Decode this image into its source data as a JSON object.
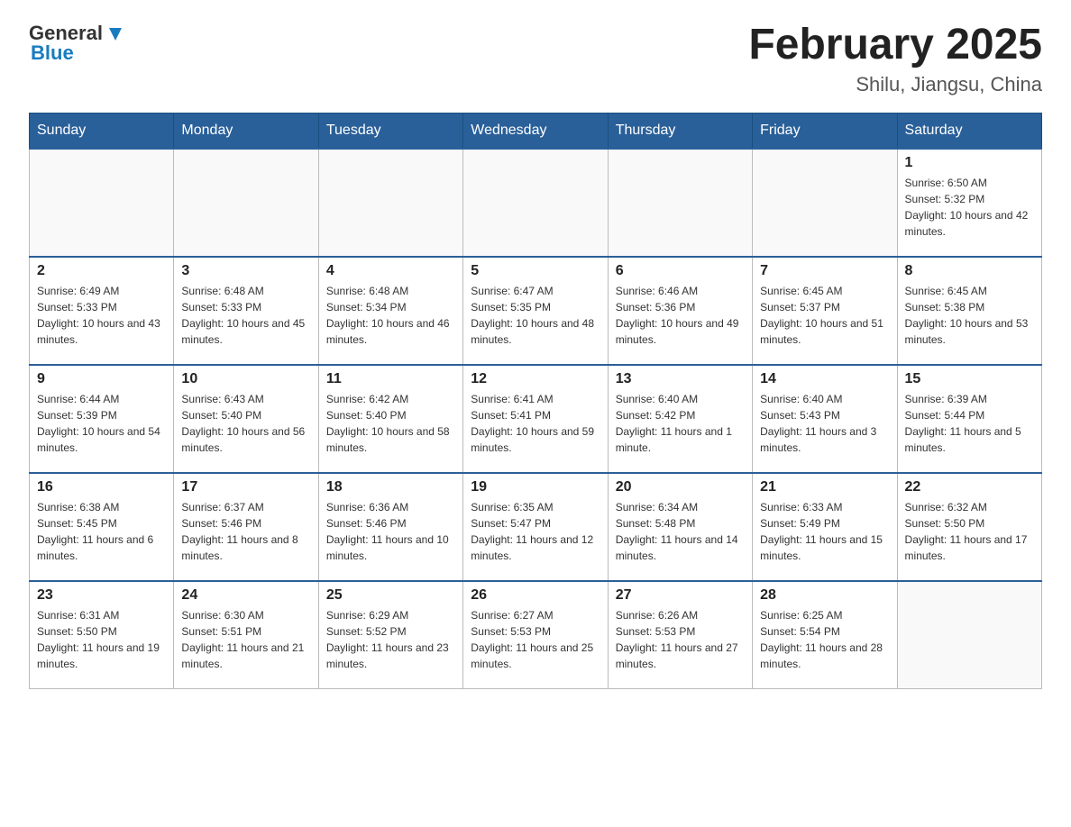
{
  "header": {
    "logo": {
      "general": "General",
      "blue": "Blue"
    },
    "title": "February 2025",
    "location": "Shilu, Jiangsu, China"
  },
  "days_of_week": [
    "Sunday",
    "Monday",
    "Tuesday",
    "Wednesday",
    "Thursday",
    "Friday",
    "Saturday"
  ],
  "weeks": [
    [
      {
        "day": "",
        "info": ""
      },
      {
        "day": "",
        "info": ""
      },
      {
        "day": "",
        "info": ""
      },
      {
        "day": "",
        "info": ""
      },
      {
        "day": "",
        "info": ""
      },
      {
        "day": "",
        "info": ""
      },
      {
        "day": "1",
        "info": "Sunrise: 6:50 AM\nSunset: 5:32 PM\nDaylight: 10 hours and 42 minutes."
      }
    ],
    [
      {
        "day": "2",
        "info": "Sunrise: 6:49 AM\nSunset: 5:33 PM\nDaylight: 10 hours and 43 minutes."
      },
      {
        "day": "3",
        "info": "Sunrise: 6:48 AM\nSunset: 5:33 PM\nDaylight: 10 hours and 45 minutes."
      },
      {
        "day": "4",
        "info": "Sunrise: 6:48 AM\nSunset: 5:34 PM\nDaylight: 10 hours and 46 minutes."
      },
      {
        "day": "5",
        "info": "Sunrise: 6:47 AM\nSunset: 5:35 PM\nDaylight: 10 hours and 48 minutes."
      },
      {
        "day": "6",
        "info": "Sunrise: 6:46 AM\nSunset: 5:36 PM\nDaylight: 10 hours and 49 minutes."
      },
      {
        "day": "7",
        "info": "Sunrise: 6:45 AM\nSunset: 5:37 PM\nDaylight: 10 hours and 51 minutes."
      },
      {
        "day": "8",
        "info": "Sunrise: 6:45 AM\nSunset: 5:38 PM\nDaylight: 10 hours and 53 minutes."
      }
    ],
    [
      {
        "day": "9",
        "info": "Sunrise: 6:44 AM\nSunset: 5:39 PM\nDaylight: 10 hours and 54 minutes."
      },
      {
        "day": "10",
        "info": "Sunrise: 6:43 AM\nSunset: 5:40 PM\nDaylight: 10 hours and 56 minutes."
      },
      {
        "day": "11",
        "info": "Sunrise: 6:42 AM\nSunset: 5:40 PM\nDaylight: 10 hours and 58 minutes."
      },
      {
        "day": "12",
        "info": "Sunrise: 6:41 AM\nSunset: 5:41 PM\nDaylight: 10 hours and 59 minutes."
      },
      {
        "day": "13",
        "info": "Sunrise: 6:40 AM\nSunset: 5:42 PM\nDaylight: 11 hours and 1 minute."
      },
      {
        "day": "14",
        "info": "Sunrise: 6:40 AM\nSunset: 5:43 PM\nDaylight: 11 hours and 3 minutes."
      },
      {
        "day": "15",
        "info": "Sunrise: 6:39 AM\nSunset: 5:44 PM\nDaylight: 11 hours and 5 minutes."
      }
    ],
    [
      {
        "day": "16",
        "info": "Sunrise: 6:38 AM\nSunset: 5:45 PM\nDaylight: 11 hours and 6 minutes."
      },
      {
        "day": "17",
        "info": "Sunrise: 6:37 AM\nSunset: 5:46 PM\nDaylight: 11 hours and 8 minutes."
      },
      {
        "day": "18",
        "info": "Sunrise: 6:36 AM\nSunset: 5:46 PM\nDaylight: 11 hours and 10 minutes."
      },
      {
        "day": "19",
        "info": "Sunrise: 6:35 AM\nSunset: 5:47 PM\nDaylight: 11 hours and 12 minutes."
      },
      {
        "day": "20",
        "info": "Sunrise: 6:34 AM\nSunset: 5:48 PM\nDaylight: 11 hours and 14 minutes."
      },
      {
        "day": "21",
        "info": "Sunrise: 6:33 AM\nSunset: 5:49 PM\nDaylight: 11 hours and 15 minutes."
      },
      {
        "day": "22",
        "info": "Sunrise: 6:32 AM\nSunset: 5:50 PM\nDaylight: 11 hours and 17 minutes."
      }
    ],
    [
      {
        "day": "23",
        "info": "Sunrise: 6:31 AM\nSunset: 5:50 PM\nDaylight: 11 hours and 19 minutes."
      },
      {
        "day": "24",
        "info": "Sunrise: 6:30 AM\nSunset: 5:51 PM\nDaylight: 11 hours and 21 minutes."
      },
      {
        "day": "25",
        "info": "Sunrise: 6:29 AM\nSunset: 5:52 PM\nDaylight: 11 hours and 23 minutes."
      },
      {
        "day": "26",
        "info": "Sunrise: 6:27 AM\nSunset: 5:53 PM\nDaylight: 11 hours and 25 minutes."
      },
      {
        "day": "27",
        "info": "Sunrise: 6:26 AM\nSunset: 5:53 PM\nDaylight: 11 hours and 27 minutes."
      },
      {
        "day": "28",
        "info": "Sunrise: 6:25 AM\nSunset: 5:54 PM\nDaylight: 11 hours and 28 minutes."
      },
      {
        "day": "",
        "info": ""
      }
    ]
  ]
}
